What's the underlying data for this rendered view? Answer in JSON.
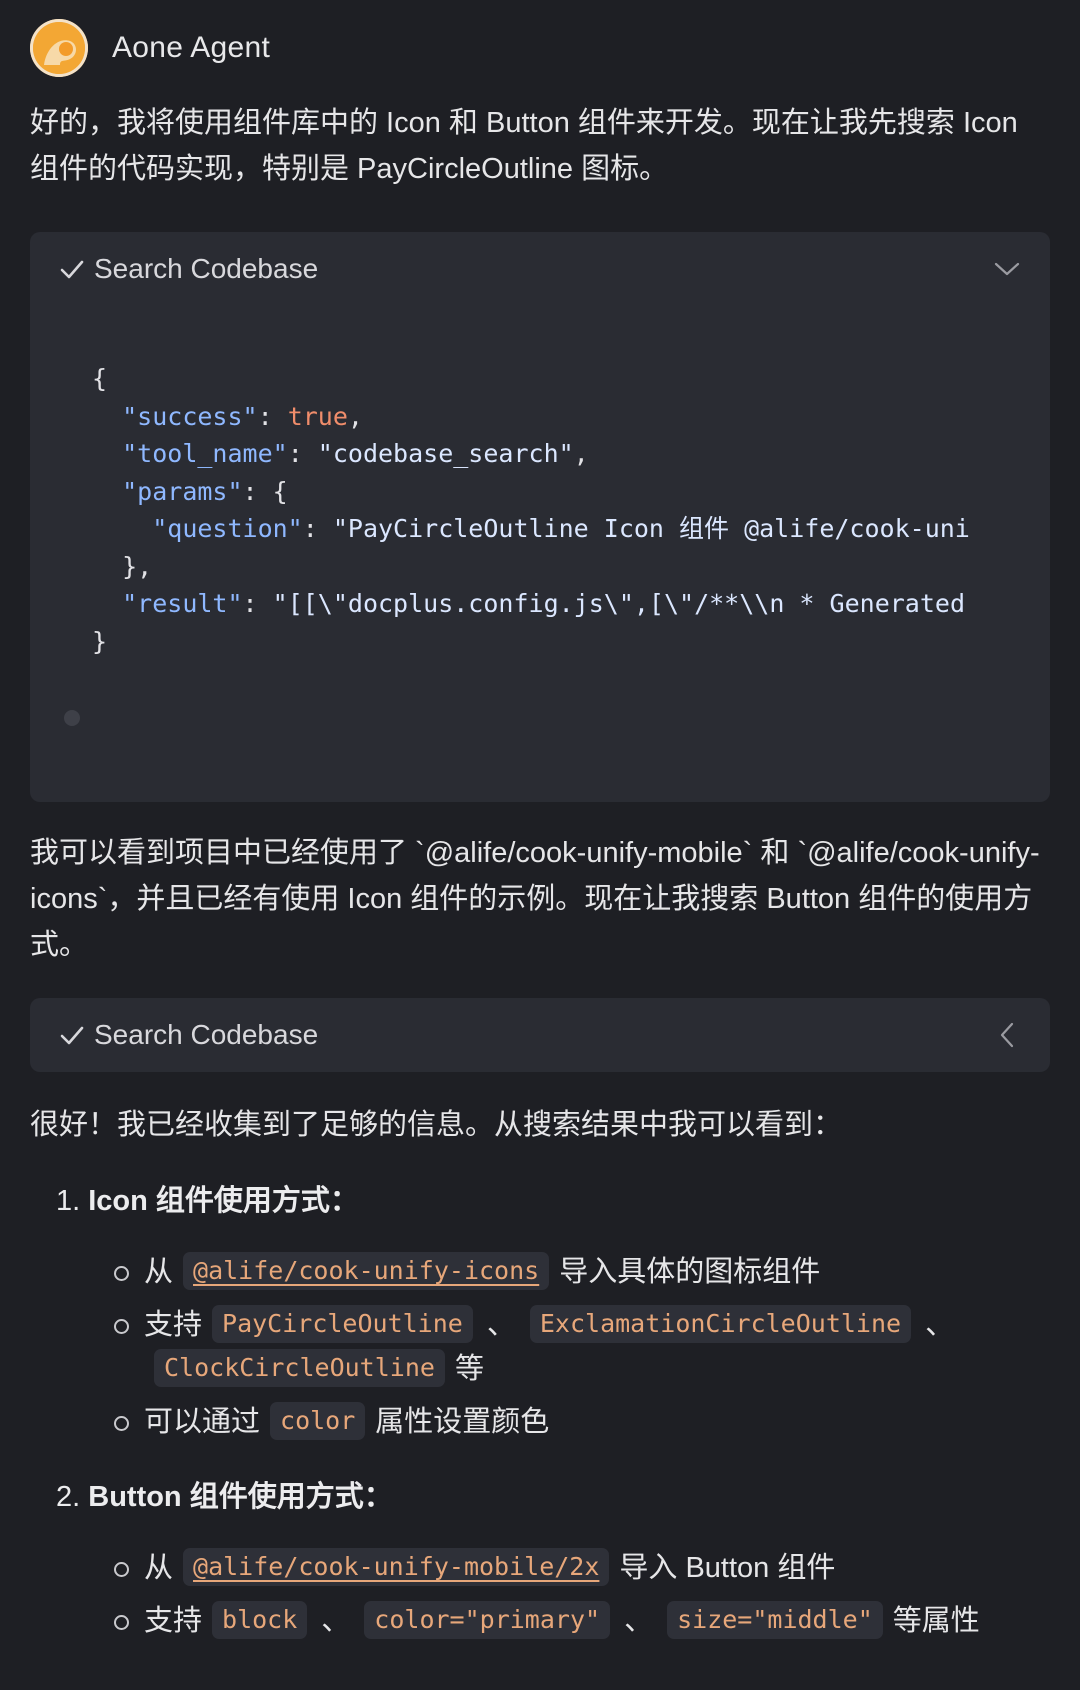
{
  "agent": {
    "name": "Aone Agent"
  },
  "intro": "好的，我将使用组件库中的 Icon 和 Button 组件来开发。现在让我先搜索 Icon 组件的代码实现，特别是 PayCircleOutline 图标。",
  "tool1": {
    "title": "Search Codebase",
    "code": {
      "open": "{",
      "success_key": "\"success\"",
      "success_val": "true",
      "tool_name_key": "\"tool_name\"",
      "tool_name_val": "\"codebase_search\"",
      "params_key": "\"params\"",
      "question_key": "\"question\"",
      "question_val": "\"PayCircleOutline Icon 组件 @alife/cook-uni",
      "params_close": "},",
      "result_key": "\"result\"",
      "result_val": "\"[[\\\"docplus.config.js\\\",[\\\"/**\\\\n * Generated",
      "close": "}"
    }
  },
  "para2": "我可以看到项目中已经使用了 `@alife/cook-unify-mobile` 和 `@alife/cook-unify-icons`，并且已经有使用 Icon 组件的示例。现在让我搜索 Button 组件的使用方式。",
  "tool2": {
    "title": "Search Codebase"
  },
  "para3": "很好！我已经收集到了足够的信息。从搜索结果中我可以看到：",
  "section1": {
    "num": "1.",
    "title": "Icon 组件使用方式：",
    "b1": {
      "pre": "从",
      "tag": "@alife/cook-unify-icons",
      "post": "导入具体的图标组件"
    },
    "b2": {
      "pre": "支持",
      "tag1": "PayCircleOutline",
      "sep1": "、",
      "tag2": "ExclamationCircleOutline",
      "sep2": "、",
      "tag3": "ClockCircleOutline",
      "post": "等"
    },
    "b3": {
      "pre": "可以通过",
      "tag": "color",
      "post": "属性设置颜色"
    }
  },
  "section2": {
    "num": "2.",
    "title": "Button 组件使用方式：",
    "b1": {
      "pre": "从",
      "tag": "@alife/cook-unify-mobile/2x",
      "post": "导入 Button 组件"
    },
    "b2": {
      "pre": "支持",
      "tag1": "block",
      "sep1": "、",
      "tag2": "color=\"primary\"",
      "sep2": "、",
      "tag3": "size=\"middle\"",
      "post": "等属性"
    }
  }
}
